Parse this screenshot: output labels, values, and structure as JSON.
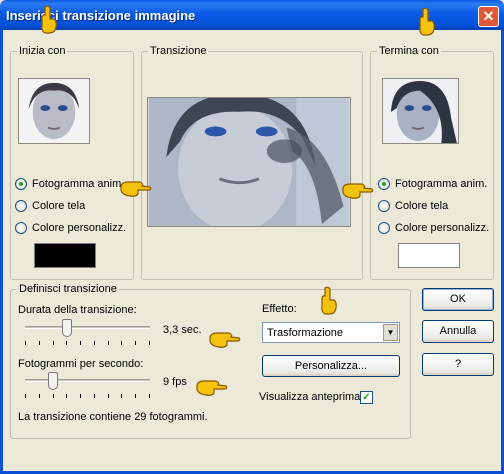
{
  "window": {
    "title": "Inserisci transizione immagine",
    "close_glyph": "✕"
  },
  "start_group": {
    "label": "Inizia con",
    "options": [
      "Fotogramma anim.",
      "Colore tela",
      "Colore personalizz."
    ],
    "selected": 0,
    "custom_color": "#000000"
  },
  "transition_group": {
    "label": "Transizione"
  },
  "end_group": {
    "label": "Termina con",
    "options": [
      "Fotogramma anim.",
      "Colore tela",
      "Colore personalizz."
    ],
    "selected": 0,
    "custom_color": "#ffffff"
  },
  "define_group": {
    "label": "Definisci transizione",
    "duration_label": "Durata della transizione:",
    "duration_value": "3,3 sec.",
    "fps_label": "Fotogrammi per secondo:",
    "fps_value": "9 fps",
    "summary": "La transizione contiene 29 fotogrammi.",
    "effect_label": "Effetto:",
    "effect_selected": "Trasformazione",
    "customize_label": "Personalizza...",
    "preview_label": "Visualizza anteprima",
    "preview_checked": true,
    "check_glyph": "✓",
    "dropdown_glyph": "▼"
  },
  "buttons": {
    "ok": "OK",
    "cancel": "Annulla",
    "help": "?"
  },
  "colors": {
    "title_bar": "#0a56e0",
    "dialog_bg": "#ece9d8",
    "pointer_hand": "#f4c20d"
  },
  "icons": [
    "pointing-hand-icon",
    "close-icon",
    "radio-icon",
    "checkbox-icon",
    "dropdown-arrow-icon"
  ]
}
